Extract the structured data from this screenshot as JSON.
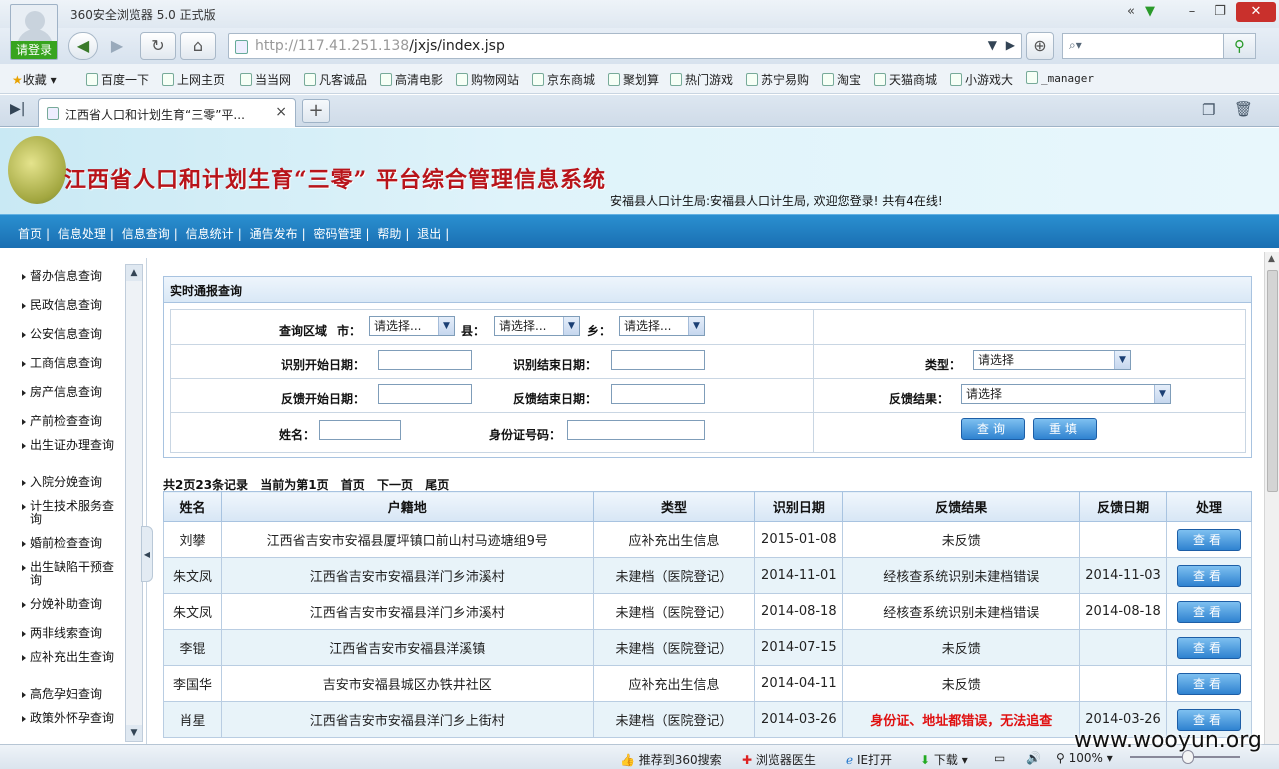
{
  "window": {
    "title": "360安全浏览器 5.0 正式版",
    "login_label": "请登录",
    "restore_label": "«"
  },
  "address": {
    "url_host": "http://117.41.251.138",
    "url_path": "/jxjs/index.jsp"
  },
  "favorites": {
    "label": "收藏",
    "items": [
      "百度一下",
      "上网主页",
      "当当网",
      "凡客诚品",
      "高清电影",
      "购物网站",
      "京东商城",
      "聚划算",
      "热门游戏",
      "苏宁易购",
      "淘宝",
      "天猫商城",
      "小游戏大",
      "_manager"
    ]
  },
  "tab": {
    "title": "江西省人口和计划生育“三零”平...",
    "close": "×",
    "new": "+"
  },
  "header": {
    "system_title": "江西省人口和计划生育“三零” 平台综合管理信息系统",
    "welcome": "安福县人口计生局:安福县人口计生局, 欢迎您登录!    共有4在线!"
  },
  "menu": {
    "items": [
      "首页",
      "信息处理",
      "信息查询",
      "信息统计",
      "通告发布",
      "密码管理",
      "帮助",
      "退出"
    ],
    "separator": "|"
  },
  "sidebar": {
    "items": [
      "督办信息查询",
      "民政信息查询",
      "公安信息查询",
      "工商信息查询",
      "房产信息查询",
      "产前检查查询",
      "出生证办理查询",
      "入院分娩查询",
      "计生技术服务查询",
      "婚前检查查询",
      "出生缺陷干预查询",
      "分娩补助查询",
      "两非线索查询",
      "应补充出生查询",
      "高危孕妇查询",
      "政策外怀孕查询"
    ]
  },
  "query": {
    "panel_title": "实时通报查询",
    "region_label": "查询区域",
    "city_label": "市：",
    "county_label": "县：",
    "township_label": "乡：",
    "city_value": "请选择...",
    "county_value": "请选择...",
    "township_value": "请选择...",
    "id_start_label": "识别开始日期：",
    "id_end_label": "识别结束日期：",
    "type_label": "类型：",
    "type_value": "请选择",
    "fb_start_label": "反馈开始日期：",
    "fb_end_label": "反馈结束日期：",
    "result_label": "反馈结果：",
    "result_value": "请选择",
    "name_label": "姓名：",
    "idcard_label": "身份证号码：",
    "search_button": "查询",
    "reset_button": "重填"
  },
  "pager": {
    "summary": "共2页23条记录",
    "current": "当前为第1页",
    "first": "首页",
    "next": "下一页",
    "last": "尾页"
  },
  "table": {
    "headers": [
      "姓名",
      "户籍地",
      "类型",
      "识别日期",
      "反馈结果",
      "反馈日期",
      "处理"
    ],
    "view_label": "查看",
    "rows": [
      {
        "name": "刘攀",
        "address": "江西省吉安市安福县厦坪镇口前山村马迹塘组9号",
        "type": "应补充出生信息",
        "id_date": "2015-01-08",
        "result": "未反馈",
        "fb_date": "",
        "red": false
      },
      {
        "name": "朱文凤",
        "address": "江西省吉安市安福县洋门乡沛溪村",
        "type": "未建档（医院登记）",
        "id_date": "2014-11-01",
        "result": "经核查系统识别未建档错误",
        "fb_date": "2014-11-03",
        "red": false
      },
      {
        "name": "朱文凤",
        "address": "江西省吉安市安福县洋门乡沛溪村",
        "type": "未建档（医院登记）",
        "id_date": "2014-08-18",
        "result": "经核查系统识别未建档错误",
        "fb_date": "2014-08-18",
        "red": false
      },
      {
        "name": "李锟",
        "address": "江西省吉安市安福县洋溪镇",
        "type": "未建档（医院登记）",
        "id_date": "2014-07-15",
        "result": "未反馈",
        "fb_date": "",
        "red": false
      },
      {
        "name": "李国华",
        "address": "吉安市安福县城区办铁井社区",
        "type": "应补充出生信息",
        "id_date": "2014-04-11",
        "result": "未反馈",
        "fb_date": "",
        "red": false
      },
      {
        "name": "肖星",
        "address": "江西省吉安市安福县洋门乡上街村",
        "type": "未建档（医院登记）",
        "id_date": "2014-03-26",
        "result": "身份证、地址都错误，无法追查",
        "fb_date": "2014-03-26",
        "red": true
      }
    ]
  },
  "statusbar": {
    "recommend": "推荐到360搜索",
    "doctor": "浏览器医生",
    "ie_open": "IE打开",
    "download": "下载",
    "zoom": "100%"
  },
  "watermark": "www.wooyun.org",
  "colors": {
    "menu_blue": "#1a6fb2",
    "title_red": "#b8141a",
    "alert_red": "#e01010",
    "button_blue": "#2f82d0"
  }
}
